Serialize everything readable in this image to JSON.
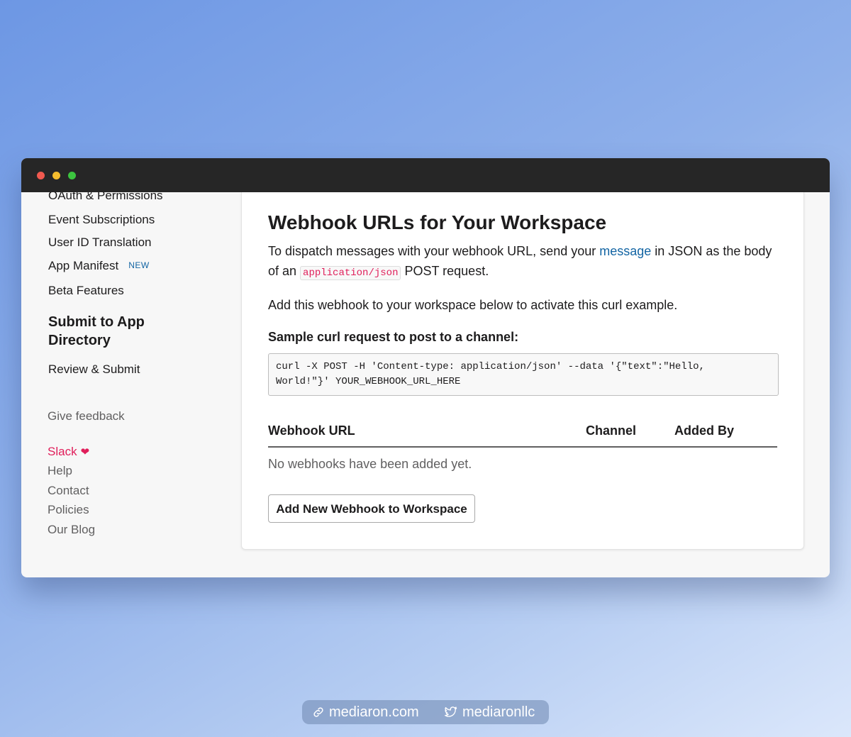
{
  "sidebar": {
    "links": [
      "OAuth & Permissions",
      "Event Subscriptions",
      "User ID Translation",
      "App Manifest",
      "Beta Features"
    ],
    "new_badge": "NEW",
    "heading": "Submit to App Directory",
    "review_link": "Review & Submit",
    "feedback": "Give feedback",
    "footer": {
      "slack": "Slack",
      "help": "Help",
      "contact": "Contact",
      "policies": "Policies",
      "blog": "Our Blog"
    }
  },
  "main": {
    "title": "Webhook URLs for Your Workspace",
    "intro_before_link": "To dispatch messages with your webhook URL, send your ",
    "intro_link": "message",
    "intro_after_link": " in JSON as the body of an ",
    "intro_code": "application/json",
    "intro_end": " POST request.",
    "activate_text": "Add this webhook to your workspace below to activate this curl example.",
    "sample_label": "Sample curl request to post to a channel:",
    "code_line1": "curl -X POST -H 'Content-type: application/json' --data '{\"text\":\"Hello,",
    "code_line2": "World!\"}' YOUR_WEBHOOK_URL_HERE",
    "table": {
      "col_url": "Webhook URL",
      "col_channel": "Channel",
      "col_added_by": "Added By",
      "empty": "No webhooks have been added yet."
    },
    "add_button": "Add New Webhook to Workspace"
  },
  "credits": {
    "site": "mediaron.com",
    "twitter": "mediaronllc"
  },
  "colors": {
    "link_blue": "#1264a3",
    "slack_pink": "#e01e5a",
    "titlebar": "#262626"
  }
}
